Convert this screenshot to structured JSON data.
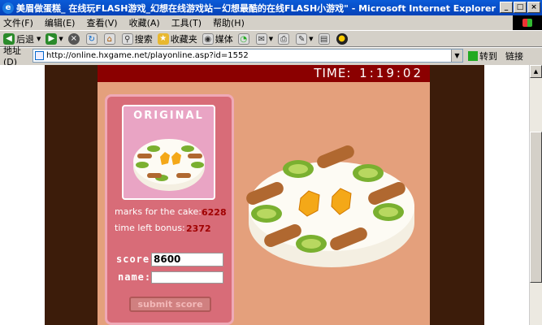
{
  "window": {
    "title": "美眉做蛋糕_ 在线玩FLASH游戏_幻想在线游戏站－幻想最酷的在线FLASH小游戏\" - Microsoft Internet Explorer",
    "minimize": "_",
    "maximize": "□",
    "close": "×"
  },
  "menu": [
    "文件(F)",
    "编辑(E)",
    "查看(V)",
    "收藏(A)",
    "工具(T)",
    "帮助(H)"
  ],
  "toolbar": {
    "back": "后退",
    "search": "搜索",
    "favorites": "收藏夹",
    "media": "媒体"
  },
  "address": {
    "label": "地址(D)",
    "url": "http://online.hxgame.net/playonline.asp?id=1552",
    "go": "转到",
    "links": "链接"
  },
  "game": {
    "time_label": "TIME:",
    "time_value": "1:19:02",
    "original_label": "ORIGINAL",
    "marks_label": "marks for the cake:",
    "marks_value": "6228",
    "bonus_label": "time left bonus:",
    "bonus_value": "2372",
    "score_label": "score:",
    "score_value": "8600",
    "name_label": "name:",
    "name_value": "",
    "submit_label": "submit score"
  },
  "colors": {
    "background_page": "#3c1c0a",
    "game_bg": "#e4a07c",
    "time_bar": "#8b0000",
    "panel": "#d86c78",
    "values_red": "#a00000"
  }
}
